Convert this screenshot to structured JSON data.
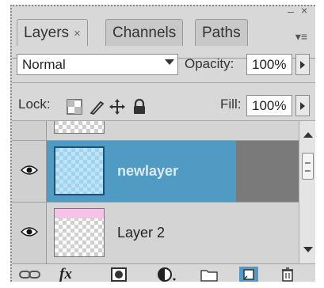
{
  "window": {
    "minimize_icon": "minimize-icon",
    "close_icon": "close-icon",
    "close_glyph": "×",
    "minimize_glyph": "–"
  },
  "tabs": [
    {
      "label": "Layers",
      "close": "×",
      "active": true
    },
    {
      "label": "Channels",
      "active": false
    },
    {
      "label": "Paths",
      "active": false
    }
  ],
  "panel_menu_glyph": "▾≡",
  "blend_mode": {
    "value": "Normal"
  },
  "opacity": {
    "label": "Opacity:",
    "value": "100%"
  },
  "lock": {
    "label": "Lock:",
    "icons": [
      "lock-transparent-icon",
      "lock-brush-icon",
      "lock-position-icon",
      "lock-all-icon"
    ]
  },
  "fill": {
    "label": "Fill:",
    "value": "100%"
  },
  "layers": [
    {
      "name": "",
      "visible": false,
      "selected": false,
      "partial": true
    },
    {
      "name": "newlayer",
      "visible": true,
      "selected": true
    },
    {
      "name": "Layer 2",
      "visible": true,
      "selected": false
    }
  ],
  "bottom_toolbar": {
    "icons": [
      "link-layers-icon",
      "fx-icon",
      "layer-mask-icon",
      "adjustment-layer-icon",
      "new-group-icon",
      "new-layer-icon",
      "trash-icon"
    ],
    "fx_label": "fx"
  },
  "colors": {
    "selected_row": "#4f9bc3",
    "panel_bg": "#d8d8d8"
  }
}
